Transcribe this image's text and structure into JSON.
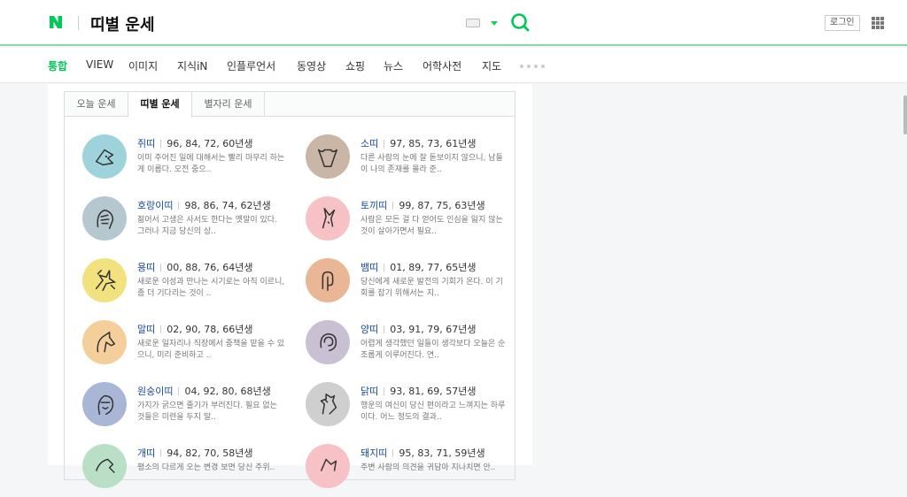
{
  "header": {
    "logo": "N",
    "page_title": "띠별 운세",
    "login_label": "로그인",
    "brand_color": "#03c75a"
  },
  "nav": {
    "items": [
      "통합",
      "VIEW",
      "이미지",
      "지식iN",
      "인플루언서",
      "동영상",
      "쇼핑",
      "뉴스",
      "어학사전",
      "지도"
    ],
    "active_index": 0
  },
  "tabs": {
    "items": [
      "오늘 운세",
      "띠별 운세",
      "별자리 운세"
    ],
    "active_index": 1
  },
  "zodiacs": [
    {
      "name": "쥐띠",
      "years": "96, 84, 72, 60년생",
      "desc": "이미 주어진 일에 대해서는 빨리 마무리 하는 게 이롭다. 오전 중으..",
      "color": "#9fd3dc",
      "icon": "rat-icon"
    },
    {
      "name": "소띠",
      "years": "97, 85, 73, 61년생",
      "desc": "다른 사람의 눈에 잘 돋보이지 않으니, 남들이 나의 존재를 몰라 준..",
      "color": "#c9b6a6",
      "icon": "ox-icon"
    },
    {
      "name": "호랑이띠",
      "years": "98, 86, 74, 62년생",
      "desc": "젊어서 고생은 사서도 한다는 옛말이 있다. 그러나 지금 당신의 상..",
      "color": "#b5c7cf",
      "icon": "tiger-icon"
    },
    {
      "name": "토끼띠",
      "years": "99, 87, 75, 63년생",
      "desc": "사람은 모든 걸 다 얻어도 인심을 잃지 않는 것이 살아가면서 필요..",
      "color": "#f7c2c5",
      "icon": "rabbit-icon"
    },
    {
      "name": "용띠",
      "years": "00, 88, 76, 64년생",
      "desc": "새로운 이성과 만나는 시기로는 아직 이르니, 좀 더 기다리는 것이 ..",
      "color": "#f2e27f",
      "icon": "dragon-icon"
    },
    {
      "name": "뱀띠",
      "years": "01, 89, 77, 65년생",
      "desc": "당신에게 새로운 발전의 기회가 온다. 이 기회를 잡기 위해서는 지..",
      "color": "#e9b795",
      "icon": "snake-icon"
    },
    {
      "name": "말띠",
      "years": "02, 90, 78, 66년생",
      "desc": "새로운 일자리나 직장에서 중책을 맡을 수 있으니, 미리 준비하고 ..",
      "color": "#f4cf9c",
      "icon": "horse-icon"
    },
    {
      "name": "양띠",
      "years": "03, 91, 79, 67년생",
      "desc": "어렵게 생각했던 일들이 생각보다 오늘은 순조롭게 이루어진다. 연..",
      "color": "#c9c0d4",
      "icon": "sheep-icon"
    },
    {
      "name": "원숭이띠",
      "years": "04, 92, 80, 68년생",
      "desc": "가지가 굵으면 줄기가 부러진다. 필요 없는 것들은 미련을 두지 말..",
      "color": "#a9b6d6",
      "icon": "monkey-icon"
    },
    {
      "name": "닭띠",
      "years": "93, 81, 69, 57년생",
      "desc": "행운의 여신이 당신 편이라고 느껴지는 하루이다. 어느 정도의 결과..",
      "color": "#cfcfcf",
      "icon": "rooster-icon"
    },
    {
      "name": "개띠",
      "years": "94, 82, 70, 58년생",
      "desc": "평소의 다르게 오는 변경 보면 당신 주위..",
      "color": "#b9e0c7",
      "icon": "dog-icon"
    },
    {
      "name": "돼지띠",
      "years": "95, 83, 71, 59년생",
      "desc": "주변 사람의 의견을 귀담아 지나치면 안..",
      "color": "#f7c2c5",
      "icon": "pig-icon"
    }
  ]
}
